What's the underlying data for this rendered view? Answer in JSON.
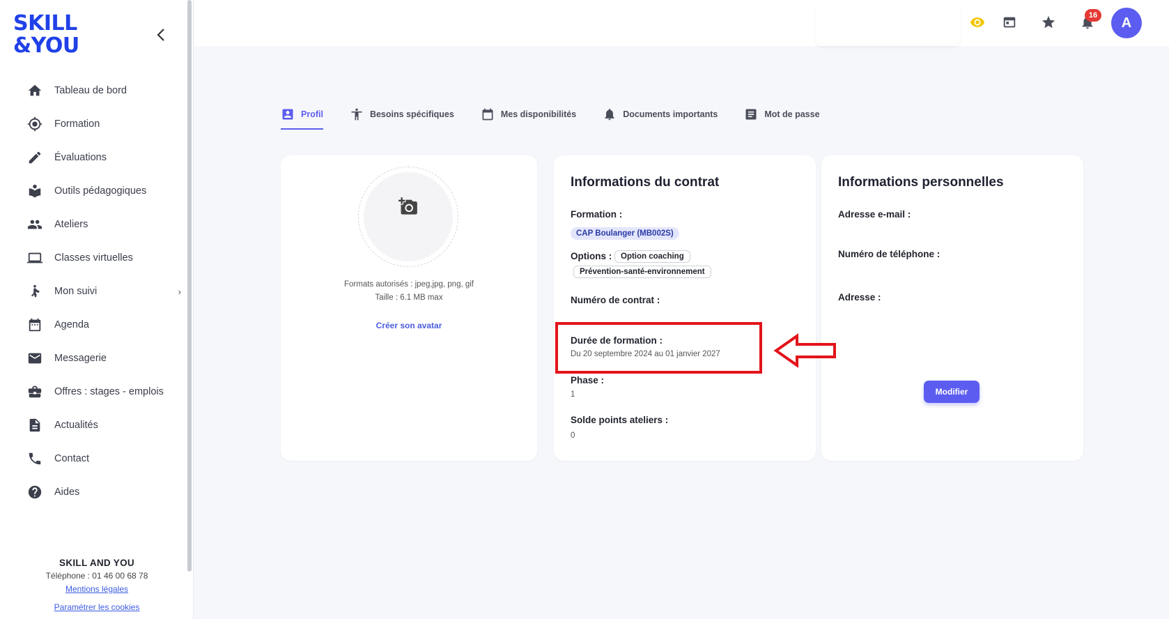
{
  "sidebar": {
    "logo_line1": "SKILL",
    "logo_line2": "&YOU",
    "items": [
      {
        "label": "Tableau de bord",
        "icon": "home-icon"
      },
      {
        "label": "Formation",
        "icon": "target-icon"
      },
      {
        "label": "Évaluations",
        "icon": "pencil-icon"
      },
      {
        "label": "Outils pédagogiques",
        "icon": "reader-icon"
      },
      {
        "label": "Ateliers",
        "icon": "people-icon"
      },
      {
        "label": "Classes virtuelles",
        "icon": "laptop-icon"
      },
      {
        "label": "Mon suivi",
        "icon": "tracking-icon"
      },
      {
        "label": "Agenda",
        "icon": "calendar-icon"
      },
      {
        "label": "Messagerie",
        "icon": "mail-icon"
      },
      {
        "label": "Offres : stages - emplois",
        "icon": "briefcase-icon"
      },
      {
        "label": "Actualités",
        "icon": "article-icon"
      },
      {
        "label": "Contact",
        "icon": "phone-icon"
      },
      {
        "label": "Aides",
        "icon": "help-icon"
      }
    ],
    "footer": {
      "brand": "SKILL AND YOU",
      "tel": "Téléphone : 01 46 00 68 78",
      "legal": "Mentions légales",
      "cookies": "Paramétrer les cookies"
    }
  },
  "topbar": {
    "notifications_count": "16",
    "avatar_letter": "A",
    "accent_eye": "#f5c400"
  },
  "tabs": [
    {
      "label": "Profil",
      "icon": "profile-icon",
      "active": true
    },
    {
      "label": "Besoins spécifiques",
      "icon": "accessibility-icon"
    },
    {
      "label": "Mes disponibilités",
      "icon": "calendar-icon"
    },
    {
      "label": "Documents importants",
      "icon": "bell-icon"
    },
    {
      "label": "Mot de passe",
      "icon": "document-icon"
    }
  ],
  "avatar_card": {
    "hint": "Ajouter une photo",
    "formats": "Formats autorisés : jpeg,jpg, png, gif",
    "size": "Taille : 6.1 MB max",
    "create_link": "Créer son avatar"
  },
  "contract": {
    "title": "Informations du contrat",
    "formation_label": "Formation :",
    "formation_value": "CAP Boulanger (MB002S)",
    "options_label": "Options :",
    "option1": "Option coaching",
    "option2": "Prévention-santé-environnement",
    "contract_number_label": "Numéro de contrat :",
    "duration_label": "Durée de formation :",
    "duration_value": "Du 20 septembre 2024 au 01 janvier 2027",
    "phase_label": "Phase :",
    "phase_value": "1",
    "points_label": "Solde points ateliers :",
    "points_value": "0"
  },
  "personal": {
    "title": "Informations personnelles",
    "email_label": "Adresse e-mail :",
    "phone_label": "Numéro de téléphone :",
    "address_label": "Adresse :",
    "edit_button": "Modifier"
  },
  "colors": {
    "accent": "#5c5df0",
    "brand": "#2041e8",
    "annotation": "#e3141b"
  }
}
